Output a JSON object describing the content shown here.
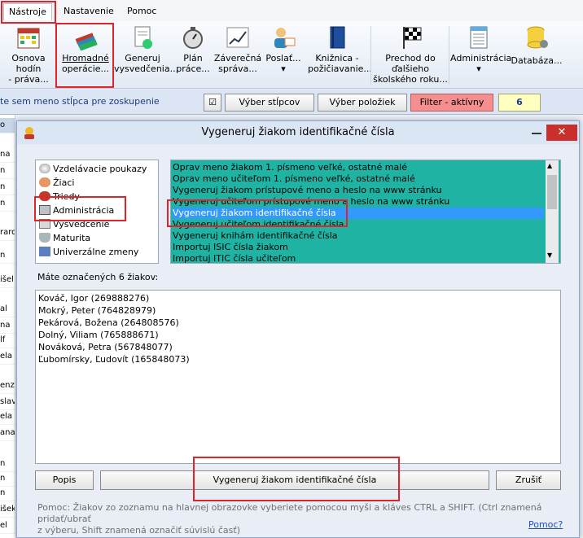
{
  "menu": {
    "tabs": [
      "Nástroje",
      "Nastavenie",
      "Pomoc"
    ]
  },
  "ribbon": {
    "buttons": [
      {
        "line1": "Osnova hodín",
        "line2": "- práva..."
      },
      {
        "line1": "Hromadné",
        "line2": "operácie..."
      },
      {
        "line1": "Generuj",
        "line2": "vysvedčenia..."
      },
      {
        "line1": "Plán",
        "line2": "práce..."
      },
      {
        "line1": "Záverečná",
        "line2": "správa..."
      },
      {
        "line1": "Poslať...",
        "line2": "▾"
      },
      {
        "line1": "Knižnica -",
        "line2": "požičiavanie..."
      },
      {
        "line1": "Prechod do",
        "line2": "ďalšieho",
        "line3": "školského roku..."
      },
      {
        "line1": "Administrácia",
        "line2": "▾"
      },
      {
        "line1": "Databáza..."
      }
    ]
  },
  "strip": {
    "group_text": "te sem meno stĺpca pre zoskupenie",
    "checkbox": "☑",
    "select_columns": "Výber stĺpcov",
    "select_items": "Výber položiek",
    "filter": "Filter - aktívny",
    "count": "6"
  },
  "background_rows": [
    "o",
    "na",
    "n",
    "n",
    "n",
    "rard",
    "n",
    "išel",
    "al",
    "na",
    "lf",
    "ela",
    "enzia",
    "slav",
    "ela",
    "ana",
    "n",
    "n",
    "n",
    "išek",
    "el",
    "na"
  ],
  "dialog": {
    "title": "Vygeneruj žiakom identifikačné čísla",
    "tree": [
      "Vzdelávacie poukazy",
      "Žiaci",
      "Triedy",
      "Administrácia",
      "Vysvedčenie",
      "Maturita",
      "Univerzálne zmeny"
    ],
    "actions": [
      "Oprav meno žiakom 1. písmeno veľké, ostatné malé",
      "Oprav meno učiteľom 1. písmeno veľké, ostatné malé",
      "Vygeneruj žiakom prístupové meno a heslo na www stránku",
      "Vygeneruj učiteľom prístupové meno a heslo na www stránku",
      "Vygeneruj žiakom identifikačné čísla",
      "Vygeneruj učiteľom identifikačné čísla",
      "Vygeneruj knihám identifikačné čísla",
      "Importuj ISIC čísla žiakom",
      "Importuj ITIC čísla učiteľom"
    ],
    "selected_action": "Vygeneruj žiakom identifikačné čísla",
    "marked_label": "Máte označených 6 žiakov:",
    "students": [
      "Kováč, Igor (269888276)",
      "Mokrý, Peter (764828979)",
      "Pekárová, Božena (264808576)",
      "Dolný, Viliam (765888671)",
      "Nováková, Petra (567848077)",
      "Ľubomírsky, Ľudovít (165848073)"
    ],
    "buttons": {
      "help": "Popis",
      "run": "Vygeneruj žiakom identifikačné čísla",
      "cancel": "Zrušiť"
    },
    "help_text_1": "Pomoc: Žiakov zo zoznamu na hlavnej obrazovke vyberiete pomocou myši a kláves CTRL a SHIFT. (Ctrl znamená pridať/ubrať",
    "help_text_2": "z výberu, Shift znamená označiť súvislú časť)",
    "help_link": "Pomoc?"
  }
}
